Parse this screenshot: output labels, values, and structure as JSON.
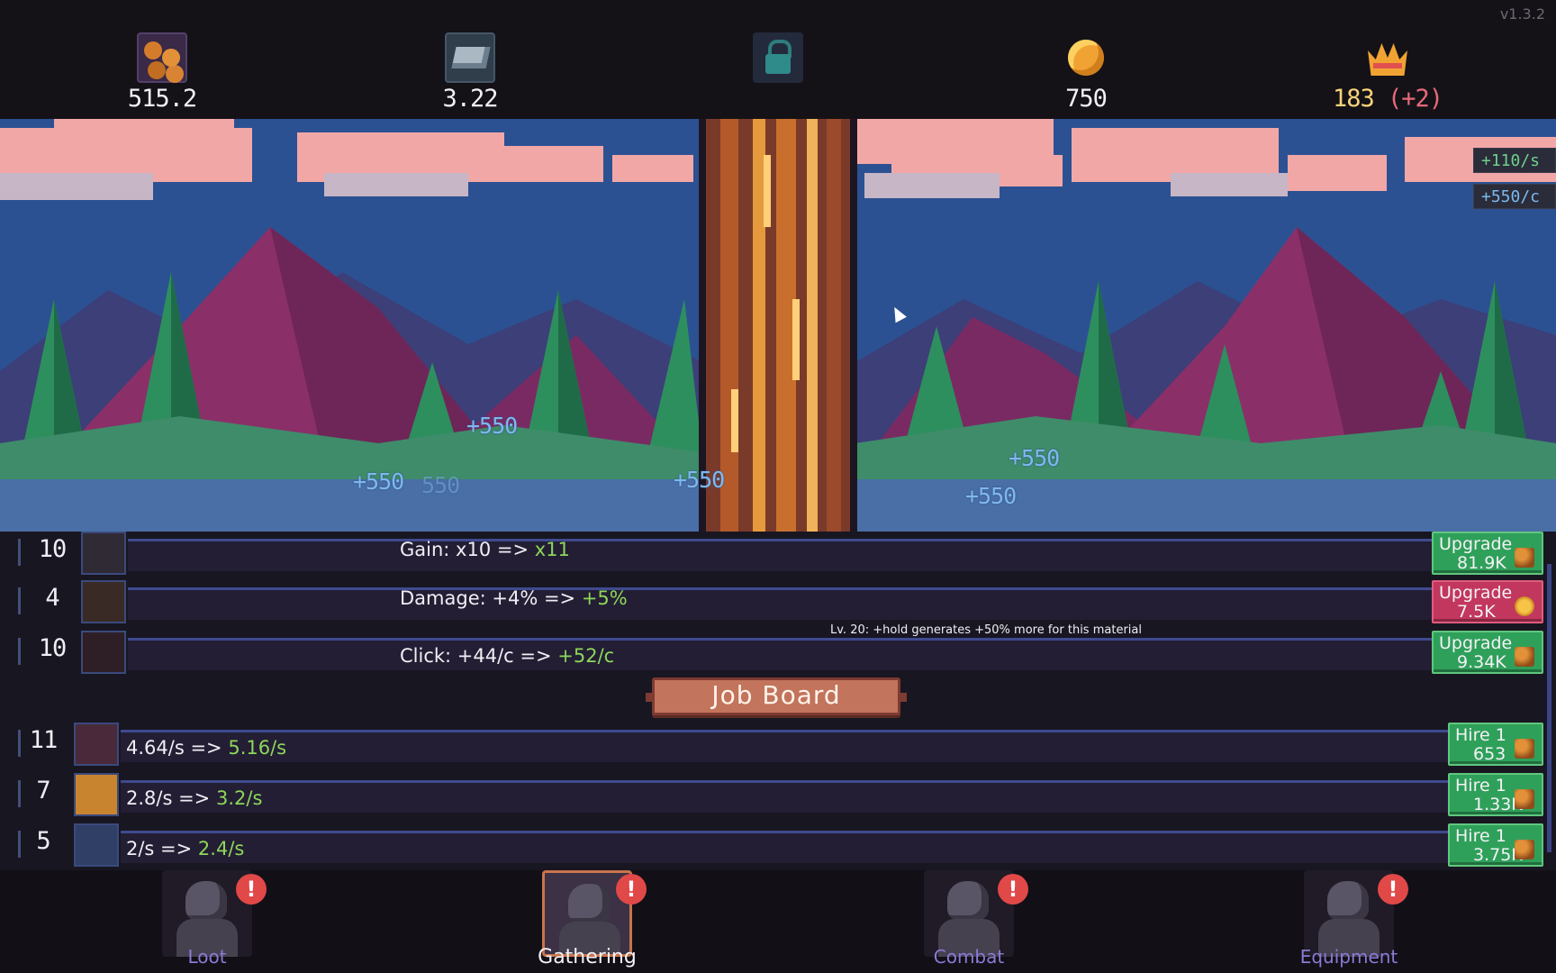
{
  "version": "v1.3.2",
  "resources": [
    {
      "id": "wood",
      "icon": "wood-logs-icon",
      "value": "515.2"
    },
    {
      "id": "iron",
      "icon": "iron-ingot-icon",
      "value": "3.22"
    },
    {
      "id": "locked",
      "icon": "lock-icon",
      "value": ""
    },
    {
      "id": "gold",
      "icon": "gold-coin-icon",
      "value": "750"
    },
    {
      "id": "crown",
      "icon": "crown-icon",
      "value": "183",
      "bonus": "(+2)"
    }
  ],
  "scene": {
    "rate_per_second": "+110/s",
    "rate_per_click": "+550/c",
    "floating_numbers": [
      "+550",
      "+550",
      "550",
      "+550",
      "+550",
      "+550"
    ]
  },
  "upgrades": [
    {
      "level": "10",
      "icon": "sawmill-icon",
      "label": "Gain: x10 => ",
      "new_value": "x11",
      "button_label": "Upgrade",
      "cost": "81.9K",
      "currency_icon": "wood-icon",
      "button_color": "#2fa05a"
    },
    {
      "level": "4",
      "icon": "workbench-icon",
      "label": "Damage: +4% => ",
      "new_value": "+5%",
      "button_label": "Upgrade",
      "cost": "7.5K",
      "currency_icon": "coin-icon",
      "button_color": "#c2375e"
    },
    {
      "level": "10",
      "icon": "axe-icon",
      "label": "Click: +44/c => ",
      "new_value": "+52/c",
      "button_label": "Upgrade",
      "cost": "9.34K",
      "currency_icon": "wood-icon",
      "button_color": "#2fa05a"
    }
  ],
  "tooltip": "Lv. 20: +hold generates +50% more for this material",
  "job_board_label": "Job Board",
  "workers": [
    {
      "count": "11",
      "icon": "goblin-worker-icon",
      "label": "4.64/s => ",
      "new_value": "5.16/s",
      "button_label": "Hire 1",
      "cost": "653",
      "currency_icon": "wood-icon"
    },
    {
      "count": "7",
      "icon": "golden-worker-icon",
      "label": "2.8/s => ",
      "new_value": "3.2/s",
      "button_label": "Hire 1",
      "cost": "1.33K",
      "currency_icon": "wood-icon"
    },
    {
      "count": "5",
      "icon": "knight-worker-icon",
      "label": "2/s => ",
      "new_value": "2.4/s",
      "button_label": "Hire 1",
      "cost": "3.75K",
      "currency_icon": "wood-icon"
    }
  ],
  "nav": [
    {
      "label": "Loot",
      "alert": "!",
      "active": false
    },
    {
      "label": "Gathering",
      "alert": "!",
      "active": true
    },
    {
      "label": "Combat",
      "alert": "!",
      "active": false
    },
    {
      "label": "Equipment",
      "alert": "!",
      "active": false
    }
  ],
  "colors": {
    "accent_green": "#8ed65a",
    "hire_green": "#2fa05a",
    "gold_cost_red": "#c2375e",
    "crown_bonus": "#e86a7a"
  }
}
